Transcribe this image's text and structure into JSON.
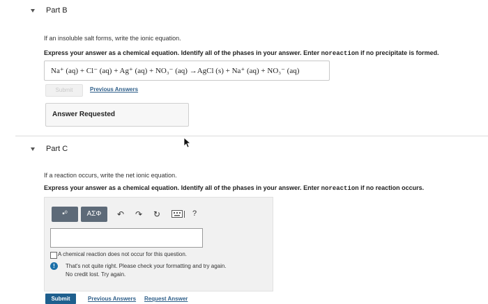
{
  "part_b": {
    "title": "Part B",
    "instruction": "If an insoluble salt forms, write the ionic equation.",
    "express": "Express your answer as a chemical equation. Identify all of the phases in your answer. Enter ",
    "keyword": "noreaction",
    "express_tail": " if no precipitate is formed.",
    "equation": "Na⁺ (aq) + Cl⁻ (aq) + Ag⁺ (aq) + NO₃⁻ (aq) →AgCl (s) + Na⁺ (aq) + NO₃⁻ (aq)",
    "submit_label": "Submit",
    "previous_answers_label": "Previous Answers",
    "answer_requested_label": "Answer Requested"
  },
  "part_c": {
    "title": "Part C",
    "instruction": "If a reaction occurs, write the net ionic equation.",
    "express": "Express your answer as a chemical equation. Identify all of the phases in your answer. Enter ",
    "keyword": "noreaction",
    "express_tail": " if no reaction occurs.",
    "toolbar": {
      "template_label": "▪⁰",
      "symbols_label": "ΑΣΦ",
      "help_label": "?"
    },
    "no_reaction_label": "A chemical reaction does not occur for this question.",
    "feedback_line1": "That's not quite right. Please check your formatting and try again.",
    "feedback_line2": "No credit lost. Try again.",
    "submit_label": "Submit",
    "previous_answers_label": "Previous Answers",
    "request_answer_label": "Request Answer"
  },
  "colors": {
    "submit_blue": "#1e5f8e",
    "toolbar_gray": "#5d6a78",
    "link_blue": "#2f5f8a",
    "info_blue": "#1b6fa8"
  }
}
